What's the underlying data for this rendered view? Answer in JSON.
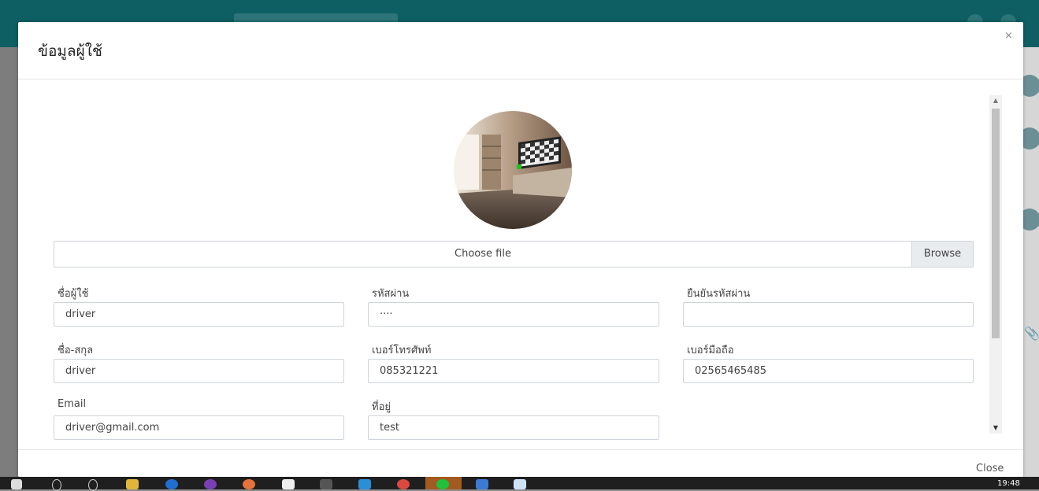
{
  "modal": {
    "title": "ข้อมูลผู้ใช้",
    "close_x": "×",
    "close_label": "Close"
  },
  "file_upload": {
    "label": "Choose file",
    "browse_label": "Browse"
  },
  "form": {
    "username": {
      "label": "ชื่อผู้ใช้",
      "value": "driver"
    },
    "password": {
      "label": "รหัสผ่าน",
      "value": "····"
    },
    "confirm_password": {
      "label": "ยืนยันรหัสผ่าน",
      "value": ""
    },
    "fullname": {
      "label": "ชื่อ-สกุล",
      "value": "driver"
    },
    "phone": {
      "label": "เบอร์โทรศัพท์",
      "value": "085321221"
    },
    "mobile": {
      "label": "เบอร์มือถือ",
      "value": "02565465485"
    },
    "email": {
      "label": "Email",
      "value": "driver@gmail.com"
    },
    "address": {
      "label": "ที่อยู่",
      "value": "test"
    }
  },
  "scrollbar": {
    "up_glyph": "▲",
    "down_glyph": "▼"
  },
  "taskbar": {
    "clock": "19:48"
  },
  "colors": {
    "topbar": "#0d5f63",
    "overlay": "#7d7d7d"
  }
}
